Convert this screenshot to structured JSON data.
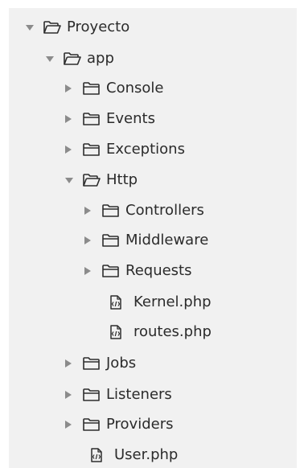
{
  "tree": {
    "items": [
      {
        "label": "Proyecto",
        "type": "folder",
        "state": "expanded",
        "arrow_icon": "chevron-down-icon",
        "item_icon": "folder-open-icon"
      },
      {
        "label": "app",
        "type": "folder",
        "state": "expanded",
        "arrow_icon": "chevron-down-icon",
        "item_icon": "folder-open-icon"
      },
      {
        "label": "Console",
        "type": "folder",
        "state": "collapsed",
        "arrow_icon": "chevron-right-icon",
        "item_icon": "folder-icon"
      },
      {
        "label": "Events",
        "type": "folder",
        "state": "collapsed",
        "arrow_icon": "chevron-right-icon",
        "item_icon": "folder-icon"
      },
      {
        "label": "Exceptions",
        "type": "folder",
        "state": "collapsed",
        "arrow_icon": "chevron-right-icon",
        "item_icon": "folder-icon"
      },
      {
        "label": "Http",
        "type": "folder",
        "state": "expanded",
        "arrow_icon": "chevron-down-icon",
        "item_icon": "folder-open-icon"
      },
      {
        "label": "Controllers",
        "type": "folder",
        "state": "collapsed",
        "arrow_icon": "chevron-right-icon",
        "item_icon": "folder-icon"
      },
      {
        "label": "Middleware",
        "type": "folder",
        "state": "collapsed",
        "arrow_icon": "chevron-right-icon",
        "item_icon": "folder-icon"
      },
      {
        "label": "Requests",
        "type": "folder",
        "state": "collapsed",
        "arrow_icon": "chevron-right-icon",
        "item_icon": "folder-icon"
      },
      {
        "label": "Kernel.php",
        "type": "file",
        "state": "file",
        "arrow_icon": "",
        "item_icon": "php-file-icon"
      },
      {
        "label": "routes.php",
        "type": "file",
        "state": "file",
        "arrow_icon": "",
        "item_icon": "php-file-icon"
      },
      {
        "label": "Jobs",
        "type": "folder",
        "state": "collapsed",
        "arrow_icon": "chevron-right-icon",
        "item_icon": "folder-icon"
      },
      {
        "label": "Listeners",
        "type": "folder",
        "state": "collapsed",
        "arrow_icon": "chevron-right-icon",
        "item_icon": "folder-icon"
      },
      {
        "label": "Providers",
        "type": "folder",
        "state": "collapsed",
        "arrow_icon": "chevron-right-icon",
        "item_icon": "folder-icon"
      },
      {
        "label": "User.php",
        "type": "file",
        "state": "file",
        "arrow_icon": "",
        "item_icon": "php-file-icon"
      }
    ]
  },
  "colors": {
    "panel_background": "#f1f1f1",
    "page_background": "#ffffff",
    "text": "#2b2b2b",
    "arrow": "#8b8b8b",
    "icon_stroke": "#2d2d2d"
  }
}
